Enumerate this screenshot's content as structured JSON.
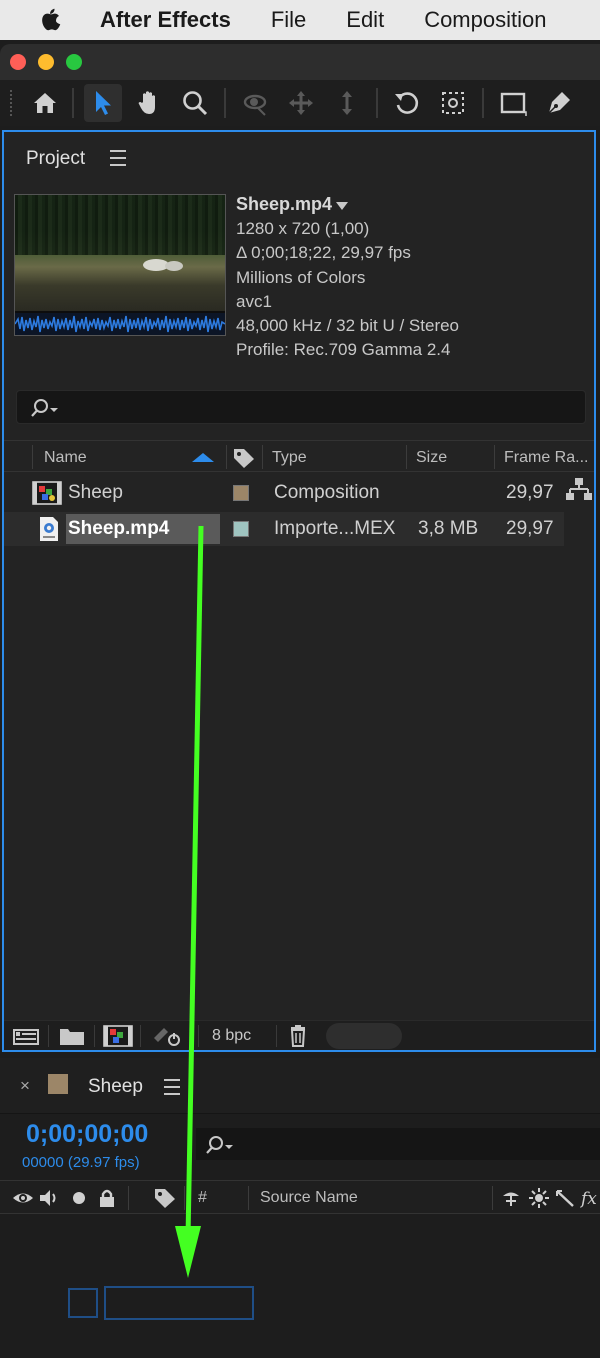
{
  "menubar": {
    "app_name": "After Effects",
    "items": [
      "File",
      "Edit",
      "Composition"
    ]
  },
  "project": {
    "title": "Project",
    "preview": {
      "filename": "Sheep.mp4",
      "lines": [
        "1280 x 720 (1,00)",
        "Δ 0;00;18;22, 29,97 fps",
        "Millions of Colors",
        "avc1",
        "48,000 kHz / 32 bit U / Stereo",
        "Profile: Rec.709 Gamma 2.4"
      ]
    },
    "columns": {
      "name": "Name",
      "type": "Type",
      "size": "Size",
      "frame_rate": "Frame Ra..."
    },
    "rows": [
      {
        "name": "Sheep",
        "type": "Composition",
        "size": "",
        "frame_rate": "29,97",
        "swatch": "#9c8668"
      },
      {
        "name": "Sheep.mp4",
        "type": "Importe...MEX",
        "size": "3,8 MB",
        "frame_rate": "29,97",
        "swatch": "#9fc4c0"
      }
    ],
    "bit_depth": "8 bpc"
  },
  "timeline": {
    "comp_name": "Sheep",
    "swatch": "#9c8668",
    "timecode": "0;00;00;00",
    "frame_info": "00000 (29.97 fps)",
    "columns": {
      "number": "#",
      "source_name": "Source Name"
    }
  },
  "colors": {
    "accent": "#2d8ceb",
    "arrow": "#44ff22"
  }
}
